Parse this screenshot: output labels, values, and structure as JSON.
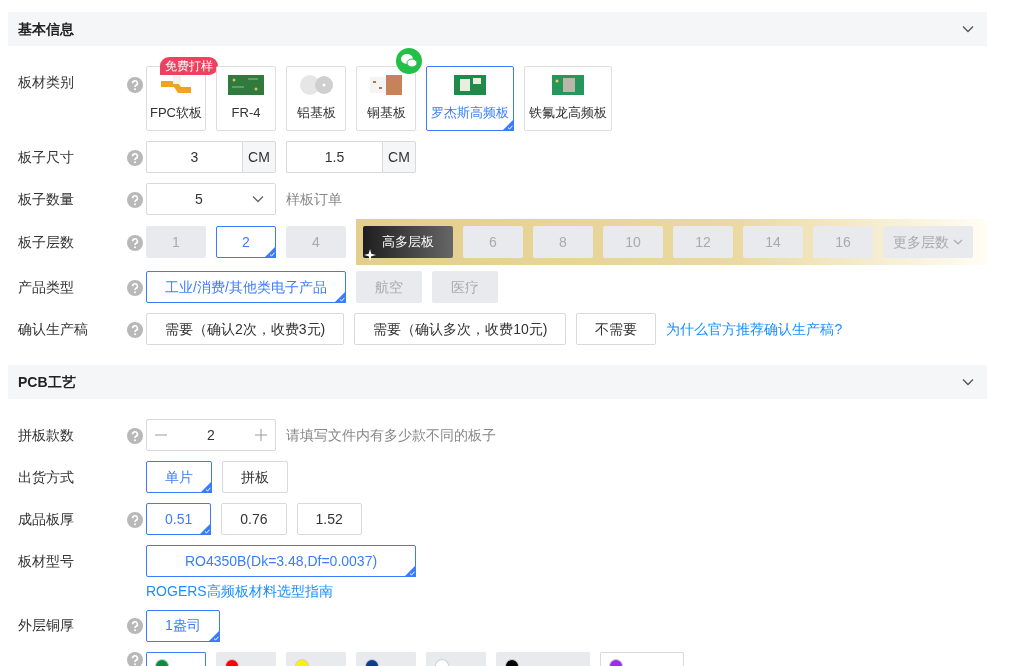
{
  "sections": [
    {
      "title": "基本信息",
      "expanded": true,
      "fields": [
        {
          "kind": "tiles",
          "label": "板材类别",
          "help": true,
          "options": [
            {
              "label": "FPC软板",
              "kind": "fpc",
              "selected": false,
              "badge": "免费打样"
            },
            {
              "label": "FR-4",
              "kind": "fr4",
              "selected": false
            },
            {
              "label": "铝基板",
              "kind": "aluminum",
              "selected": false
            },
            {
              "label": "铜基板",
              "kind": "copper",
              "selected": false,
              "chat": true
            },
            {
              "label": "罗杰斯高频板",
              "kind": "rogers",
              "selected": true
            },
            {
              "label": "铁氟龙高频板",
              "kind": "ptfe",
              "selected": false
            }
          ]
        },
        {
          "kind": "size",
          "label": "板子尺寸",
          "help": true,
          "inputs": [
            {
              "value": "3",
              "unit": "CM"
            },
            {
              "value": "1.5",
              "unit": "CM"
            }
          ]
        },
        {
          "kind": "select",
          "label": "板子数量",
          "help": true,
          "value": "5",
          "note": "样板订单"
        },
        {
          "kind": "options",
          "label": "板子层数",
          "help": true,
          "options": [
            {
              "label": "1",
              "selected": false,
              "disabled": true
            },
            {
              "label": "2",
              "selected": true,
              "disabled": false
            },
            {
              "label": "4",
              "selected": false,
              "disabled": true
            }
          ],
          "premium": {
            "title": "高多层板",
            "more": "更多层数",
            "options": [
              {
                "label": "6",
                "selected": false,
                "disabled": true
              },
              {
                "label": "8",
                "selected": false,
                "disabled": true
              },
              {
                "label": "10",
                "selected": false,
                "disabled": true
              },
              {
                "label": "12",
                "selected": false,
                "disabled": true
              },
              {
                "label": "14",
                "selected": false,
                "disabled": true
              },
              {
                "label": "16",
                "selected": false,
                "disabled": true
              }
            ]
          }
        },
        {
          "kind": "options",
          "label": "产品类型",
          "help": true,
          "options": [
            {
              "label": "工业/消费/其他类电子产品",
              "selected": true,
              "disabled": false
            },
            {
              "label": "航空",
              "selected": false,
              "disabled": true
            },
            {
              "label": "医疗",
              "selected": false,
              "disabled": true
            }
          ]
        },
        {
          "kind": "options",
          "label": "确认生产稿",
          "help": true,
          "options": [
            {
              "label": "需要（确认2次，收费3元)",
              "selected": false,
              "disabled": false
            },
            {
              "label": "需要（确认多次，收费10元)",
              "selected": false,
              "disabled": false
            },
            {
              "label": "不需要",
              "selected": false,
              "disabled": false
            }
          ],
          "link": "为什么官方推荐确认生产稿?"
        }
      ]
    },
    {
      "title": "PCB工艺",
      "expanded": true,
      "fields": [
        {
          "kind": "stepper",
          "label": "拼板款数",
          "help": true,
          "value": "2",
          "note": "请填写文件内有多少款不同的板子"
        },
        {
          "kind": "options",
          "label": "出货方式",
          "help": false,
          "options": [
            {
              "label": "单片",
              "selected": true,
              "disabled": false
            },
            {
              "label": "拼板",
              "selected": false,
              "disabled": false
            }
          ]
        },
        {
          "kind": "options",
          "label": "成品板厚",
          "help": true,
          "options": [
            {
              "label": "0.51",
              "selected": true,
              "disabled": false
            },
            {
              "label": "0.76",
              "selected": false,
              "disabled": false
            },
            {
              "label": "1.52",
              "selected": false,
              "disabled": false
            }
          ]
        },
        {
          "kind": "options",
          "label": "板材型号",
          "help": false,
          "wide": true,
          "options": [
            {
              "label": "RO4350B(Dk=3.48,Df=0.0037)",
              "selected": true,
              "disabled": false
            }
          ],
          "below_link": "ROGERS高频板材料选型指南"
        },
        {
          "kind": "options",
          "label": "外层铜厚",
          "help": true,
          "options": [
            {
              "label": "1盎司",
              "selected": true,
              "disabled": false
            }
          ]
        },
        {
          "kind": "colors",
          "help": true,
          "options": [
            {
              "color": "#0a8f3c",
              "selected": true,
              "disabled": false
            },
            {
              "color": "#ff0000",
              "selected": false,
              "disabled": true
            },
            {
              "color": "#fff000",
              "selected": false,
              "disabled": true
            },
            {
              "color": "#0a3d91",
              "selected": false,
              "disabled": true
            },
            {
              "color": "#ffffff",
              "selected": false,
              "disabled": true
            },
            {
              "color": "#000000",
              "selected": false,
              "disabled": true
            },
            {
              "color": "#9b2cf0",
              "selected": false,
              "disabled": false
            }
          ]
        }
      ]
    }
  ]
}
